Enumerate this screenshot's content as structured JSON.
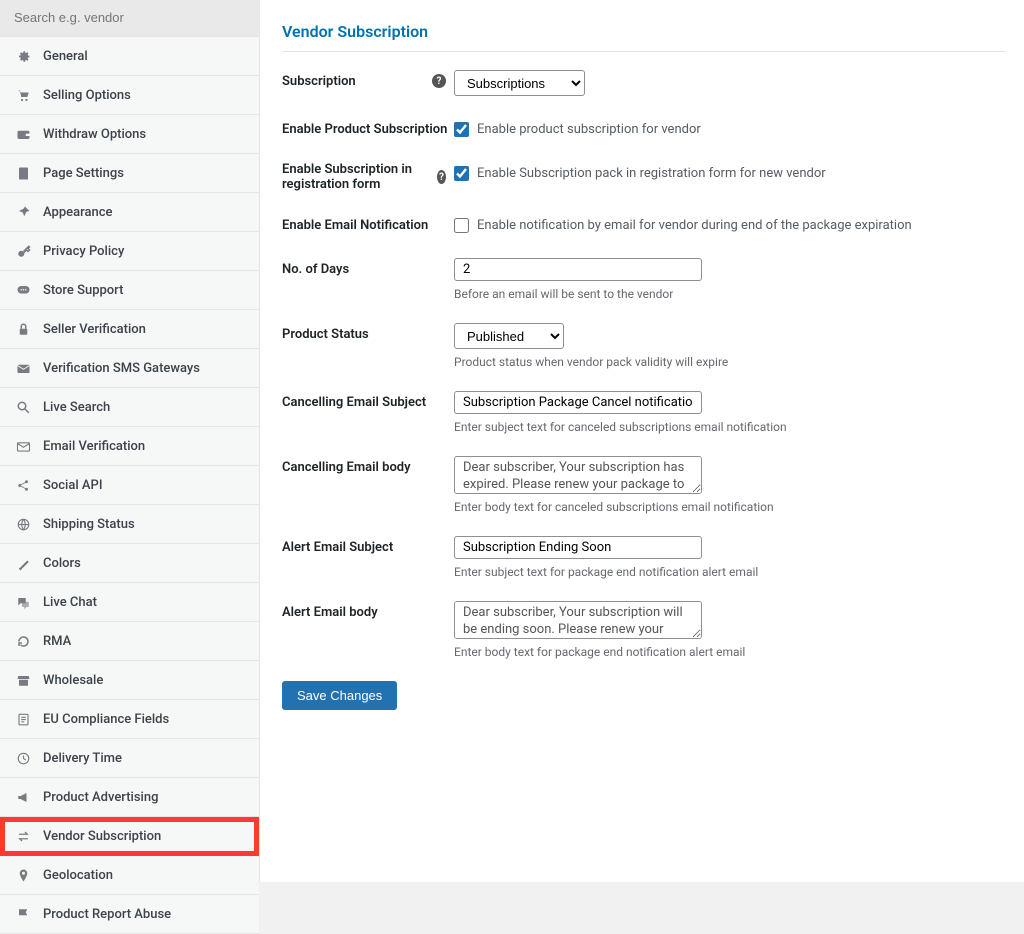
{
  "sidebar": {
    "search_placeholder": "Search e.g. vendor",
    "items": [
      {
        "label": "General",
        "icon": "gear",
        "cls": "ic-blue"
      },
      {
        "label": "Selling Options",
        "icon": "cart",
        "cls": "ic-teal"
      },
      {
        "label": "Withdraw Options",
        "icon": "wallet",
        "cls": "ic-orange"
      },
      {
        "label": "Page Settings",
        "icon": "page",
        "cls": "ic-purple"
      },
      {
        "label": "Appearance",
        "icon": "pin",
        "cls": "ic-pin"
      },
      {
        "label": "Privacy Policy",
        "icon": "key",
        "cls": "ic-grey"
      },
      {
        "label": "Store Support",
        "icon": "chat",
        "cls": "ic-grey"
      },
      {
        "label": "Seller Verification",
        "icon": "lock",
        "cls": "ic-grey"
      },
      {
        "label": "Verification SMS Gateways",
        "icon": "mail",
        "cls": "ic-grey"
      },
      {
        "label": "Live Search",
        "icon": "search",
        "cls": "ic-grey"
      },
      {
        "label": "Email Verification",
        "icon": "envelope",
        "cls": "ic-grey"
      },
      {
        "label": "Social API",
        "icon": "share",
        "cls": "ic-green"
      },
      {
        "label": "Shipping Status",
        "icon": "globe",
        "cls": "ic-grey"
      },
      {
        "label": "Colors",
        "icon": "brush",
        "cls": "ic-grey"
      },
      {
        "label": "Live Chat",
        "icon": "comments",
        "cls": "ic-grey"
      },
      {
        "label": "RMA",
        "icon": "refresh",
        "cls": "ic-grey"
      },
      {
        "label": "Wholesale",
        "icon": "store",
        "cls": "ic-grey"
      },
      {
        "label": "EU Compliance Fields",
        "icon": "doc",
        "cls": "ic-grey"
      },
      {
        "label": "Delivery Time",
        "icon": "clock",
        "cls": "ic-grey"
      },
      {
        "label": "Product Advertising",
        "icon": "megaphone",
        "cls": "ic-grey"
      },
      {
        "label": "Vendor Subscription",
        "icon": "swap",
        "cls": "ic-grey",
        "active": true
      },
      {
        "label": "Geolocation",
        "icon": "pinmap",
        "cls": "ic-grey"
      },
      {
        "label": "Product Report Abuse",
        "icon": "flag",
        "cls": "ic-grey"
      }
    ]
  },
  "page": {
    "title": "Vendor Subscription",
    "subscription": {
      "label": "Subscription",
      "value": "Subscriptions",
      "help": true
    },
    "enable_product": {
      "label": "Enable Product Subscription",
      "checked": true,
      "text": "Enable product subscription for vendor"
    },
    "enable_reg": {
      "label": "Enable Subscription in registration form",
      "checked": true,
      "text": "Enable Subscription pack in registration form for new vendor",
      "help": true
    },
    "enable_email": {
      "label": "Enable Email Notification",
      "checked": false,
      "text": "Enable notification by email for vendor during end of the package expiration"
    },
    "no_days": {
      "label": "No. of Days",
      "value": "2",
      "desc": "Before an email will be sent to the vendor"
    },
    "product_status": {
      "label": "Product Status",
      "value": "Published",
      "desc": "Product status when vendor pack validity will expire"
    },
    "cancel_subject": {
      "label": "Cancelling Email Subject",
      "value": "Subscription Package Cancel notification",
      "desc": "Enter subject text for canceled subscriptions email notification"
    },
    "cancel_body": {
      "label": "Cancelling Email body",
      "value": "Dear subscriber, Your subscription has expired. Please renew your package to continue using it.",
      "desc": "Enter body text for canceled subscriptions email notification"
    },
    "alert_subject": {
      "label": "Alert Email Subject",
      "value": "Subscription Ending Soon",
      "desc": "Enter subject text for package end notification alert email"
    },
    "alert_body": {
      "label": "Alert Email body",
      "value": "Dear subscriber, Your subscription will be ending soon. Please renew your package in a timely",
      "desc": "Enter body text for package end notification alert email"
    },
    "save": "Save Changes"
  }
}
